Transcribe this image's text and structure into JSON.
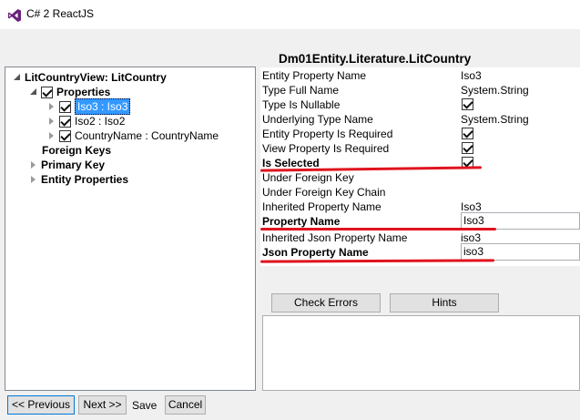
{
  "window": {
    "title": "C# 2 ReactJS"
  },
  "tree": {
    "root": "LitCountryView: LitCountry",
    "properties_label": "Properties",
    "items": [
      "Iso3 : Iso3",
      "Iso2 : Iso2",
      "CountryName : CountryName"
    ],
    "foreign_keys": "Foreign Keys",
    "primary_key": "Primary Key",
    "entity_properties": "Entity Properties"
  },
  "details": {
    "heading": "Dm01Entity.Literature.LitCountry",
    "rows": [
      {
        "name": "Entity Property Name",
        "value": "Iso3"
      },
      {
        "name": "Type Full Name",
        "value": "System.String"
      },
      {
        "name": "Type Is Nullable",
        "checked": true
      },
      {
        "name": "Underlying Type Name",
        "value": "System.String"
      },
      {
        "name": "Entity Property Is Required",
        "checked": true
      },
      {
        "name": "View Property Is Required",
        "checked": true
      },
      {
        "name": "Is Selected",
        "checked": true
      },
      {
        "name": "Under Foreign Key"
      },
      {
        "name": "Under Foreign Key Chain"
      },
      {
        "name": "Inherited Property Name",
        "value": "Iso3"
      },
      {
        "name": "Property Name",
        "value": "Iso3"
      },
      {
        "name": "Inherited Json Property Name",
        "value": "iso3"
      },
      {
        "name": "Json Property Name",
        "value": "iso3"
      }
    ]
  },
  "actions": {
    "check_errors": "Check Errors",
    "hints": "Hints"
  },
  "nav": {
    "previous": "<< Previous",
    "next": "Next >>",
    "save": "Save",
    "cancel": "Cancel"
  },
  "colors": {
    "annotation_red": "#e0141e",
    "selection_blue": "#3399ff",
    "vs_purple": "#68217a"
  }
}
